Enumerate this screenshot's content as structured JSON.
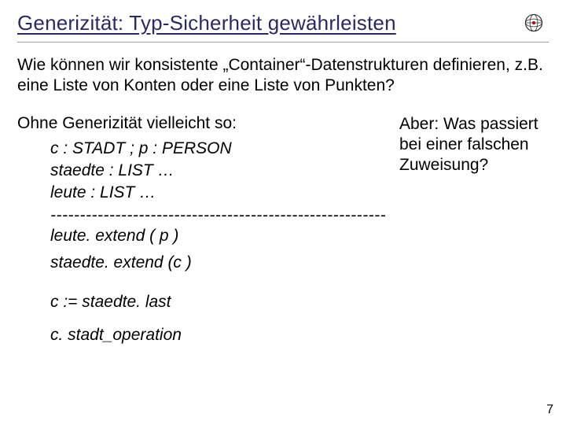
{
  "title": "Generizität: Typ-Sicherheit gewährleisten",
  "question": "Wie können wir konsistente „Container“-Datenstrukturen definieren, z.B. eine Liste von Konten oder eine Liste von Punkten?",
  "intro": "Ohne Generizität vielleicht so:",
  "decl_line1": "c : STADT ; p : PERSON",
  "decl_line2": "staedte : LIST …",
  "decl_line3": "leute : LIST …",
  "aside": "Aber: Was passiert bei einer falschen Zuweisung?",
  "dashes": "---------------------------------------------------------",
  "call1": "leute. extend   ( p )",
  "call2": "staedte. extend  (c )",
  "assign": "c := staedte. last",
  "op": "c. stadt_operation",
  "page_number": "7"
}
